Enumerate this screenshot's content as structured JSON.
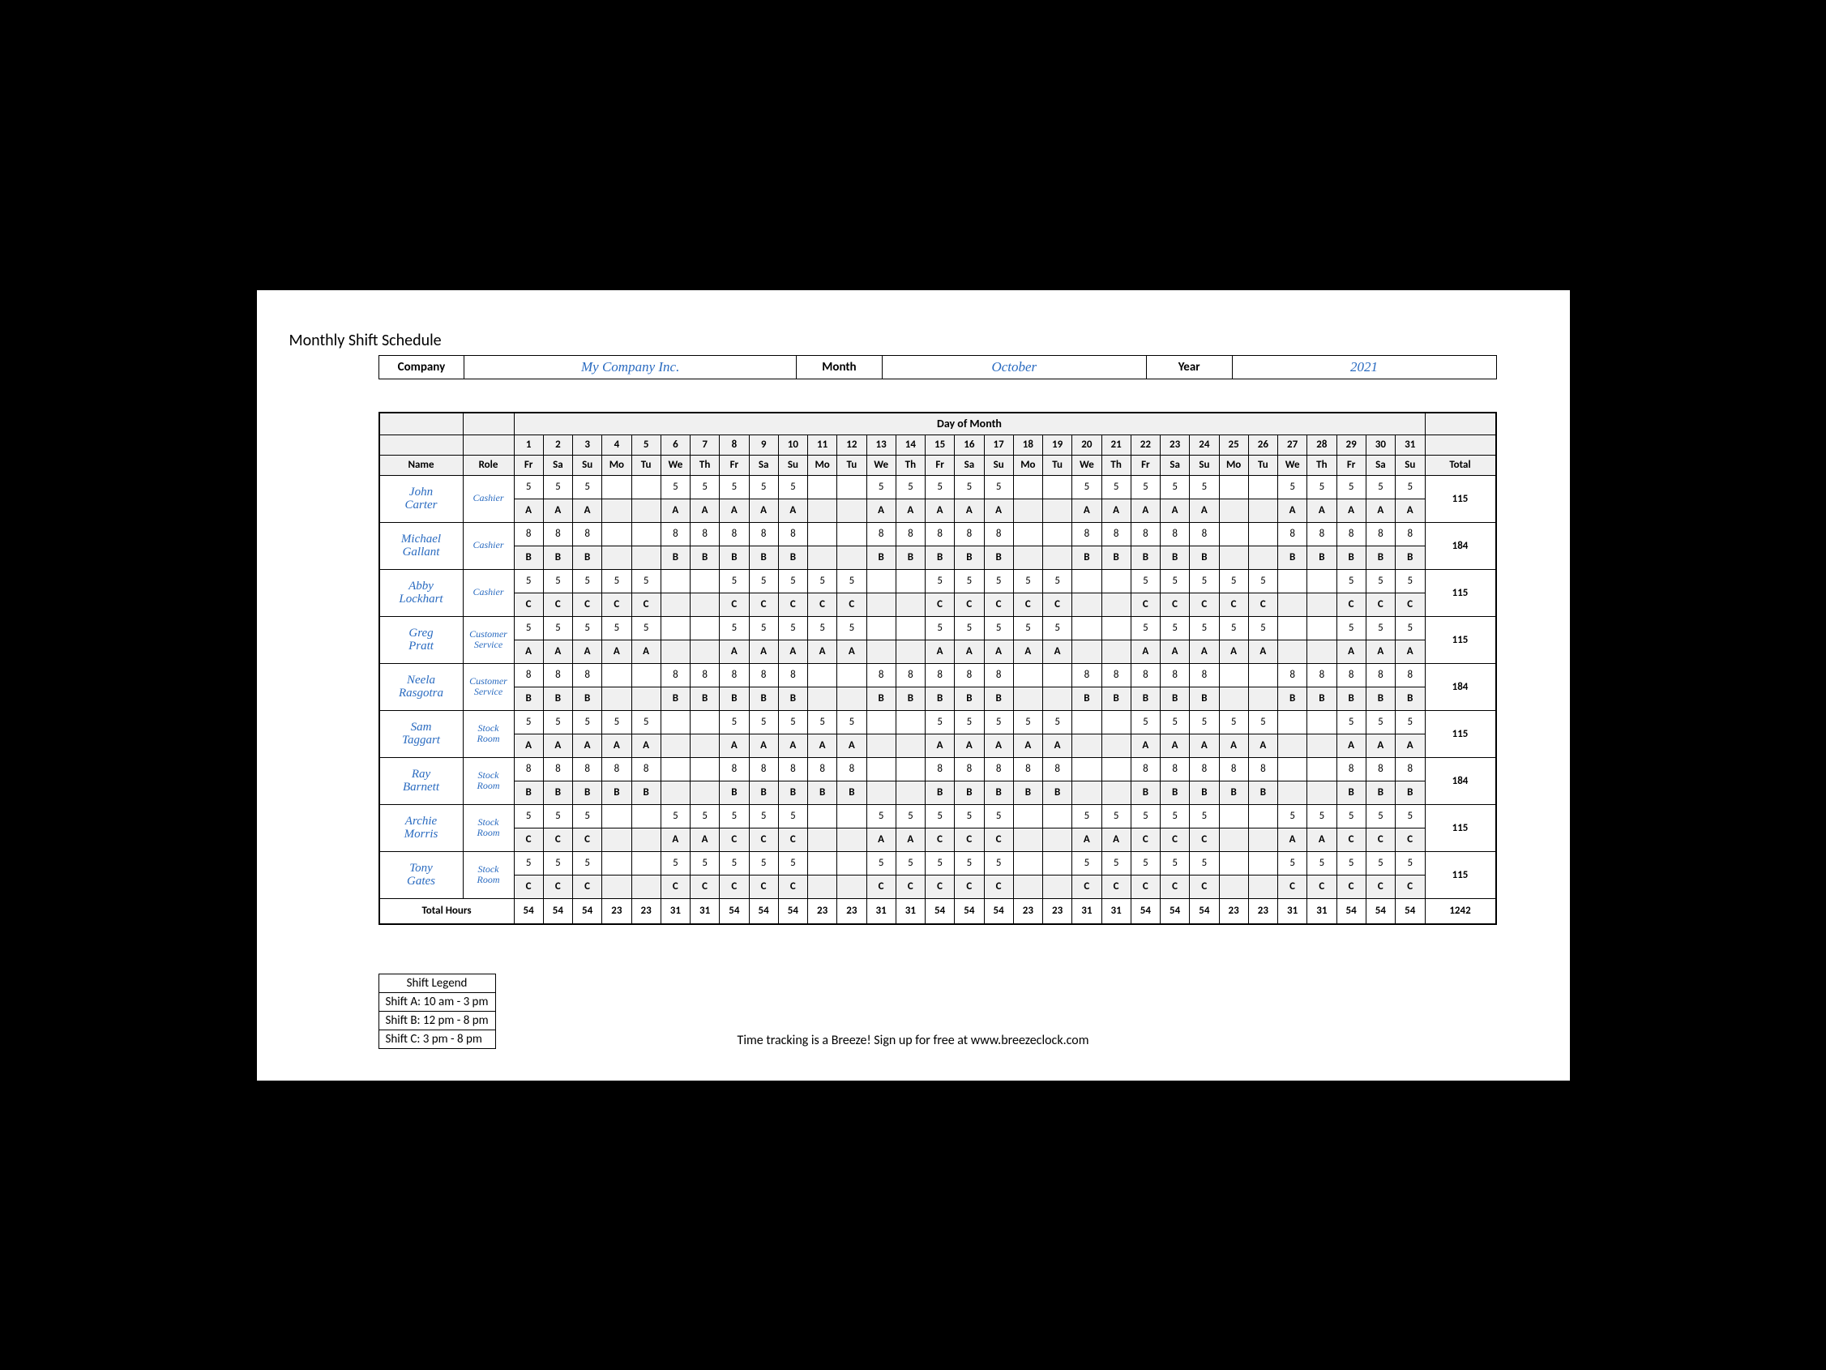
{
  "title": "Monthly Shift Schedule",
  "header": {
    "company_label": "Company",
    "company_value": "My Company Inc.",
    "month_label": "Month",
    "month_value": "October",
    "year_label": "Year",
    "year_value": "2021"
  },
  "day_of_month_label": "Day of Month",
  "name_label": "Name",
  "role_label": "Role",
  "total_label": "Total",
  "total_hours_label": "Total Hours",
  "days": [
    "1",
    "2",
    "3",
    "4",
    "5",
    "6",
    "7",
    "8",
    "9",
    "10",
    "11",
    "12",
    "13",
    "14",
    "15",
    "16",
    "17",
    "18",
    "19",
    "20",
    "21",
    "22",
    "23",
    "24",
    "25",
    "26",
    "27",
    "28",
    "29",
    "30",
    "31"
  ],
  "weekdays": [
    "Fr",
    "Sa",
    "Su",
    "Mo",
    "Tu",
    "We",
    "Th",
    "Fr",
    "Sa",
    "Su",
    "Mo",
    "Tu",
    "We",
    "Th",
    "Fr",
    "Sa",
    "Su",
    "Mo",
    "Tu",
    "We",
    "Th",
    "Fr",
    "Sa",
    "Su",
    "Mo",
    "Tu",
    "We",
    "Th",
    "Fr",
    "Sa",
    "Su"
  ],
  "employees": [
    {
      "name": "John Carter",
      "role": "Cashier",
      "hours": [
        "5",
        "5",
        "5",
        "",
        "",
        "5",
        "5",
        "5",
        "5",
        "5",
        "",
        "",
        "5",
        "5",
        "5",
        "5",
        "5",
        "",
        "",
        "5",
        "5",
        "5",
        "5",
        "5",
        "",
        "",
        "5",
        "5",
        "5",
        "5",
        "5"
      ],
      "shifts": [
        "A",
        "A",
        "A",
        "",
        "",
        "A",
        "A",
        "A",
        "A",
        "A",
        "",
        "",
        "A",
        "A",
        "A",
        "A",
        "A",
        "",
        "",
        "A",
        "A",
        "A",
        "A",
        "A",
        "",
        "",
        "A",
        "A",
        "A",
        "A",
        "A"
      ],
      "total": "115"
    },
    {
      "name": "Michael Gallant",
      "role": "Cashier",
      "hours": [
        "8",
        "8",
        "8",
        "",
        "",
        "8",
        "8",
        "8",
        "8",
        "8",
        "",
        "",
        "8",
        "8",
        "8",
        "8",
        "8",
        "",
        "",
        "8",
        "8",
        "8",
        "8",
        "8",
        "",
        "",
        "8",
        "8",
        "8",
        "8",
        "8"
      ],
      "shifts": [
        "B",
        "B",
        "B",
        "",
        "",
        "B",
        "B",
        "B",
        "B",
        "B",
        "",
        "",
        "B",
        "B",
        "B",
        "B",
        "B",
        "",
        "",
        "B",
        "B",
        "B",
        "B",
        "B",
        "",
        "",
        "B",
        "B",
        "B",
        "B",
        "B"
      ],
      "total": "184"
    },
    {
      "name": "Abby Lockhart",
      "role": "Cashier",
      "hours": [
        "5",
        "5",
        "5",
        "5",
        "5",
        "",
        "",
        "5",
        "5",
        "5",
        "5",
        "5",
        "",
        "",
        "5",
        "5",
        "5",
        "5",
        "5",
        "",
        "",
        "5",
        "5",
        "5",
        "5",
        "5",
        "",
        "",
        "5",
        "5",
        "5"
      ],
      "shifts": [
        "C",
        "C",
        "C",
        "C",
        "C",
        "",
        "",
        "C",
        "C",
        "C",
        "C",
        "C",
        "",
        "",
        "C",
        "C",
        "C",
        "C",
        "C",
        "",
        "",
        "C",
        "C",
        "C",
        "C",
        "C",
        "",
        "",
        "C",
        "C",
        "C"
      ],
      "total": "115"
    },
    {
      "name": "Greg Pratt",
      "role": "Customer Service",
      "hours": [
        "5",
        "5",
        "5",
        "5",
        "5",
        "",
        "",
        "5",
        "5",
        "5",
        "5",
        "5",
        "",
        "",
        "5",
        "5",
        "5",
        "5",
        "5",
        "",
        "",
        "5",
        "5",
        "5",
        "5",
        "5",
        "",
        "",
        "5",
        "5",
        "5"
      ],
      "shifts": [
        "A",
        "A",
        "A",
        "A",
        "A",
        "",
        "",
        "A",
        "A",
        "A",
        "A",
        "A",
        "",
        "",
        "A",
        "A",
        "A",
        "A",
        "A",
        "",
        "",
        "A",
        "A",
        "A",
        "A",
        "A",
        "",
        "",
        "A",
        "A",
        "A"
      ],
      "total": "115"
    },
    {
      "name": "Neela Rasgotra",
      "role": "Customer Service",
      "hours": [
        "8",
        "8",
        "8",
        "",
        "",
        "8",
        "8",
        "8",
        "8",
        "8",
        "",
        "",
        "8",
        "8",
        "8",
        "8",
        "8",
        "",
        "",
        "8",
        "8",
        "8",
        "8",
        "8",
        "",
        "",
        "8",
        "8",
        "8",
        "8",
        "8"
      ],
      "shifts": [
        "B",
        "B",
        "B",
        "",
        "",
        "B",
        "B",
        "B",
        "B",
        "B",
        "",
        "",
        "B",
        "B",
        "B",
        "B",
        "B",
        "",
        "",
        "B",
        "B",
        "B",
        "B",
        "B",
        "",
        "",
        "B",
        "B",
        "B",
        "B",
        "B"
      ],
      "total": "184"
    },
    {
      "name": "Sam Taggart",
      "role": "Stock Room",
      "hours": [
        "5",
        "5",
        "5",
        "5",
        "5",
        "",
        "",
        "5",
        "5",
        "5",
        "5",
        "5",
        "",
        "",
        "5",
        "5",
        "5",
        "5",
        "5",
        "",
        "",
        "5",
        "5",
        "5",
        "5",
        "5",
        "",
        "",
        "5",
        "5",
        "5"
      ],
      "shifts": [
        "A",
        "A",
        "A",
        "A",
        "A",
        "",
        "",
        "A",
        "A",
        "A",
        "A",
        "A",
        "",
        "",
        "A",
        "A",
        "A",
        "A",
        "A",
        "",
        "",
        "A",
        "A",
        "A",
        "A",
        "A",
        "",
        "",
        "A",
        "A",
        "A"
      ],
      "total": "115"
    },
    {
      "name": "Ray Barnett",
      "role": "Stock Room",
      "hours": [
        "8",
        "8",
        "8",
        "8",
        "8",
        "",
        "",
        "8",
        "8",
        "8",
        "8",
        "8",
        "",
        "",
        "8",
        "8",
        "8",
        "8",
        "8",
        "",
        "",
        "8",
        "8",
        "8",
        "8",
        "8",
        "",
        "",
        "8",
        "8",
        "8"
      ],
      "shifts": [
        "B",
        "B",
        "B",
        "B",
        "B",
        "",
        "",
        "B",
        "B",
        "B",
        "B",
        "B",
        "",
        "",
        "B",
        "B",
        "B",
        "B",
        "B",
        "",
        "",
        "B",
        "B",
        "B",
        "B",
        "B",
        "",
        "",
        "B",
        "B",
        "B"
      ],
      "total": "184"
    },
    {
      "name": "Archie Morris",
      "role": "Stock Room",
      "hours": [
        "5",
        "5",
        "5",
        "",
        "",
        "5",
        "5",
        "5",
        "5",
        "5",
        "",
        "",
        "5",
        "5",
        "5",
        "5",
        "5",
        "",
        "",
        "5",
        "5",
        "5",
        "5",
        "5",
        "",
        "",
        "5",
        "5",
        "5",
        "5",
        "5"
      ],
      "shifts": [
        "C",
        "C",
        "C",
        "",
        "",
        "A",
        "A",
        "C",
        "C",
        "C",
        "",
        "",
        "A",
        "A",
        "C",
        "C",
        "C",
        "",
        "",
        "A",
        "A",
        "C",
        "C",
        "C",
        "",
        "",
        "A",
        "A",
        "C",
        "C",
        "C"
      ],
      "total": "115"
    },
    {
      "name": "Tony Gates",
      "role": "Stock Room",
      "hours": [
        "5",
        "5",
        "5",
        "",
        "",
        "5",
        "5",
        "5",
        "5",
        "5",
        "",
        "",
        "5",
        "5",
        "5",
        "5",
        "5",
        "",
        "",
        "5",
        "5",
        "5",
        "5",
        "5",
        "",
        "",
        "5",
        "5",
        "5",
        "5",
        "5"
      ],
      "shifts": [
        "C",
        "C",
        "C",
        "",
        "",
        "C",
        "C",
        "C",
        "C",
        "C",
        "",
        "",
        "C",
        "C",
        "C",
        "C",
        "C",
        "",
        "",
        "C",
        "C",
        "C",
        "C",
        "C",
        "",
        "",
        "C",
        "C",
        "C",
        "C",
        "C"
      ],
      "total": "115"
    }
  ],
  "totals_row": [
    "54",
    "54",
    "54",
    "23",
    "23",
    "31",
    "31",
    "54",
    "54",
    "54",
    "23",
    "23",
    "31",
    "31",
    "54",
    "54",
    "54",
    "23",
    "23",
    "31",
    "31",
    "54",
    "54",
    "54",
    "23",
    "23",
    "31",
    "31",
    "54",
    "54",
    "54"
  ],
  "grand_total": "1242",
  "legend": {
    "title": "Shift Legend",
    "rows": [
      "Shift A: 10 am - 3 pm",
      "Shift B: 12 pm - 8 pm",
      "Shift C: 3 pm - 8 pm"
    ]
  },
  "footer": "Time tracking is a Breeze! Sign up for free at www.breezeclock.com"
}
